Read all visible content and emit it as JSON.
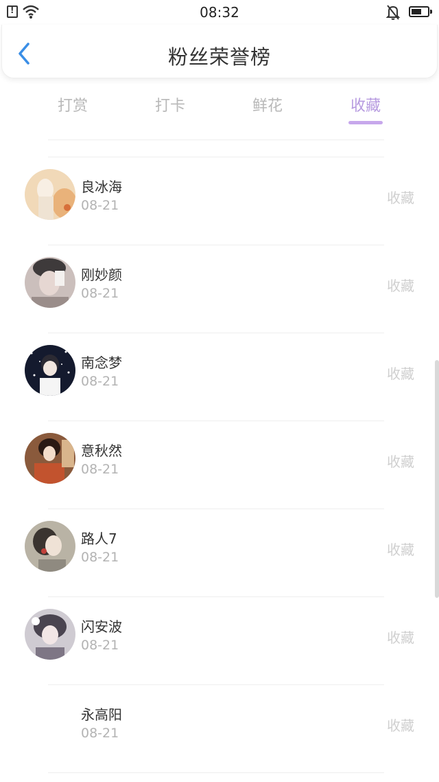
{
  "status_bar": {
    "time": "08:32"
  },
  "header": {
    "title": "粉丝荣誉榜"
  },
  "tabs": [
    {
      "label": "打赏",
      "active": false
    },
    {
      "label": "打卡",
      "active": false
    },
    {
      "label": "鲜花",
      "active": false
    },
    {
      "label": "收藏",
      "active": true
    }
  ],
  "colors": {
    "accent": "#b79be0",
    "muted": "#b8b8b8"
  },
  "fans": [
    {
      "name": "良冰海",
      "date": "08-21",
      "action": "收藏"
    },
    {
      "name": "刚妙颜",
      "date": "08-21",
      "action": "收藏"
    },
    {
      "name": "南念梦",
      "date": "08-21",
      "action": "收藏"
    },
    {
      "name": "意秋然",
      "date": "08-21",
      "action": "收藏"
    },
    {
      "name": "路人7",
      "date": "08-21",
      "action": "收藏"
    },
    {
      "name": "闪安波",
      "date": "08-21",
      "action": "收藏"
    },
    {
      "name": "永高阳",
      "date": "08-21",
      "action": "收藏"
    }
  ]
}
